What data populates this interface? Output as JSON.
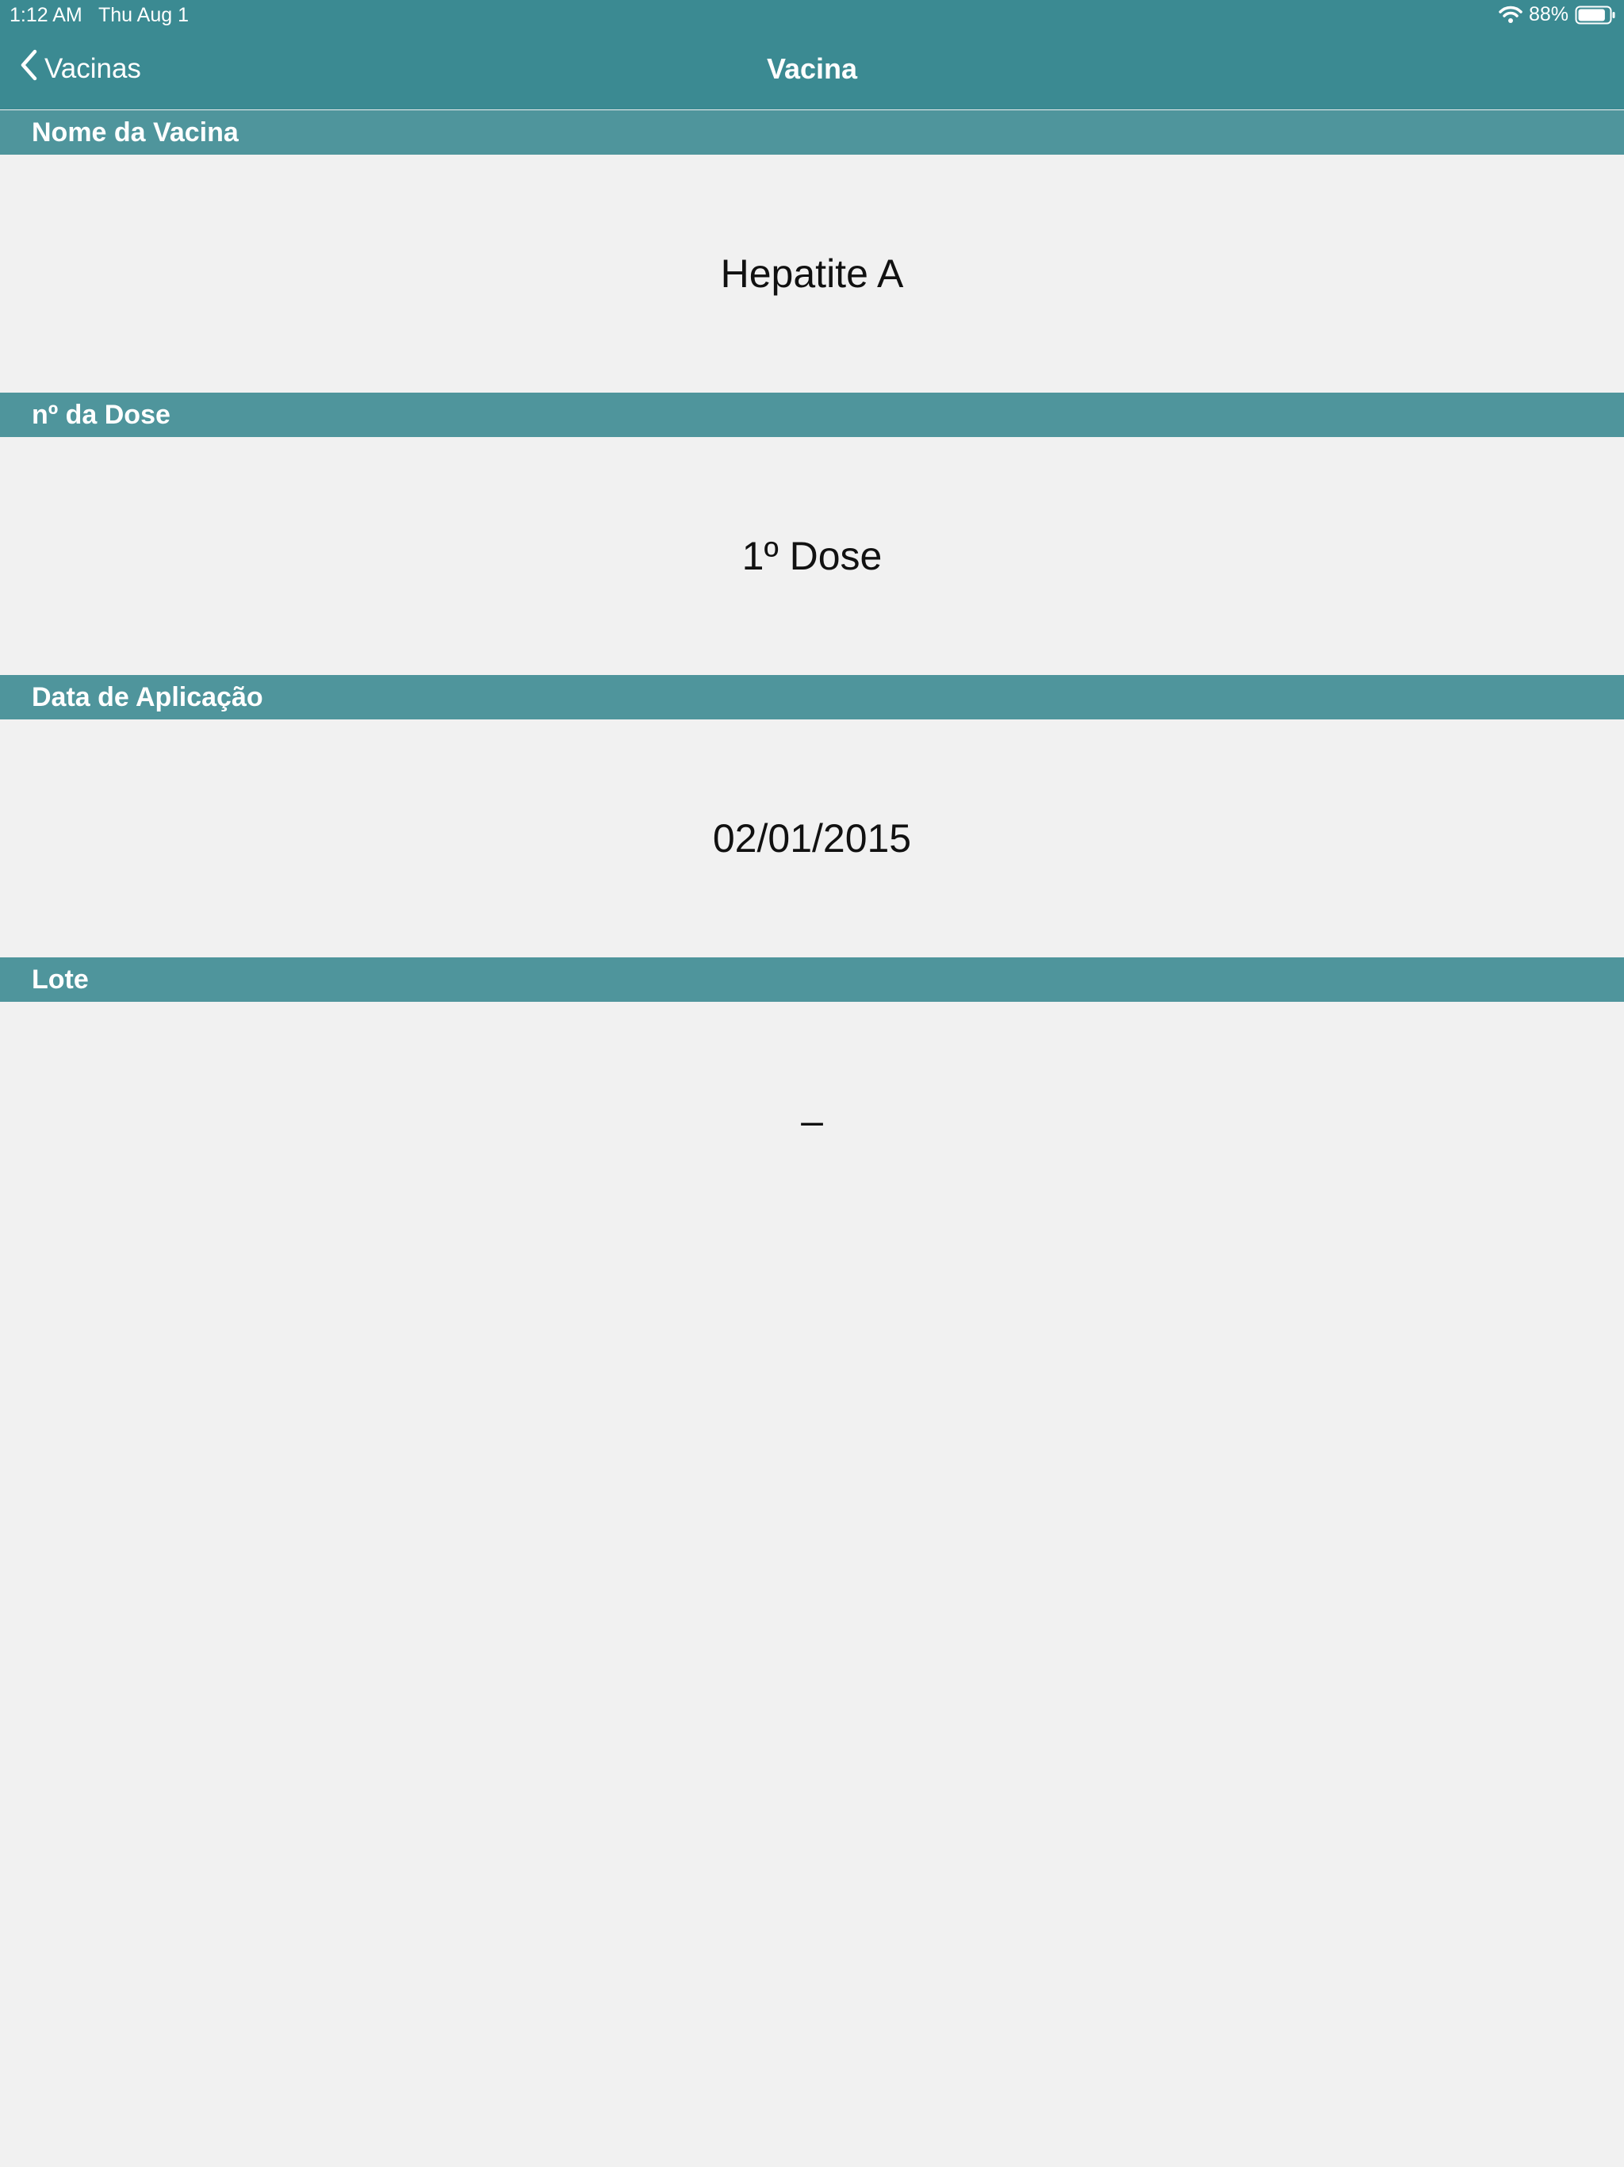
{
  "status_bar": {
    "time": "1:12 AM",
    "date": "Thu Aug 1",
    "battery_percent": "88%",
    "battery_level": 0.88
  },
  "nav": {
    "back_label": "Vacinas",
    "title": "Vacina"
  },
  "sections": [
    {
      "header": "Nome da Vacina",
      "value": "Hepatite A"
    },
    {
      "header": "nº da Dose",
      "value": "1º Dose"
    },
    {
      "header": "Data de Aplicação",
      "value": "02/01/2015"
    },
    {
      "header": "Lote",
      "value": "–"
    }
  ],
  "colors": {
    "nav_background": "#3b8a92",
    "section_header_background": "#4f959c",
    "content_background": "#f1f1f1"
  }
}
